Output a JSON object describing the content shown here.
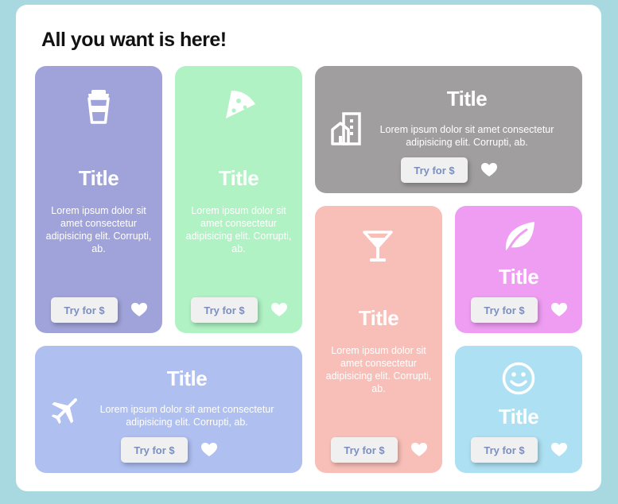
{
  "page": {
    "heading": "All you want is here!"
  },
  "cards": [
    {
      "id": "coffee",
      "icon": "coffee-cup-icon",
      "color": "#a0a3d9",
      "title": "Title",
      "text": "Lorem ipsum dolor sit amet consectetur adipisicing elit. Corrupti, ab.",
      "button": "Try for $"
    },
    {
      "id": "pizza",
      "icon": "pizza-slice-icon",
      "color": "#b0f2c4",
      "title": "Title",
      "text": "Lorem ipsum dolor sit amet consectetur adipisicing elit. Corrupti, ab.",
      "button": "Try for $"
    },
    {
      "id": "building",
      "icon": "building-icon",
      "color": "#a09e9e",
      "title": "Title",
      "text": "Lorem ipsum dolor sit amet consectetur adipisicing elit. Corrupti, ab.",
      "button": "Try for $"
    },
    {
      "id": "cocktail",
      "icon": "cocktail-glass-icon",
      "color": "#f8bfb8",
      "title": "Title",
      "text": "Lorem ipsum dolor sit amet consectetur adipisicing elit. Corrupti, ab.",
      "button": "Try for $"
    },
    {
      "id": "leaf",
      "icon": "leaf-icon",
      "color": "#ee9df2",
      "title": "Title",
      "button": "Try for $"
    },
    {
      "id": "plane",
      "icon": "airplane-icon",
      "color": "#aebff0",
      "title": "Title",
      "text": "Lorem ipsum dolor sit amet consectetur adipisicing elit. Corrupti, ab.",
      "button": "Try for $"
    },
    {
      "id": "smile",
      "icon": "smiley-face-icon",
      "color": "#ade0f2",
      "title": "Title",
      "button": "Try for $"
    }
  ]
}
